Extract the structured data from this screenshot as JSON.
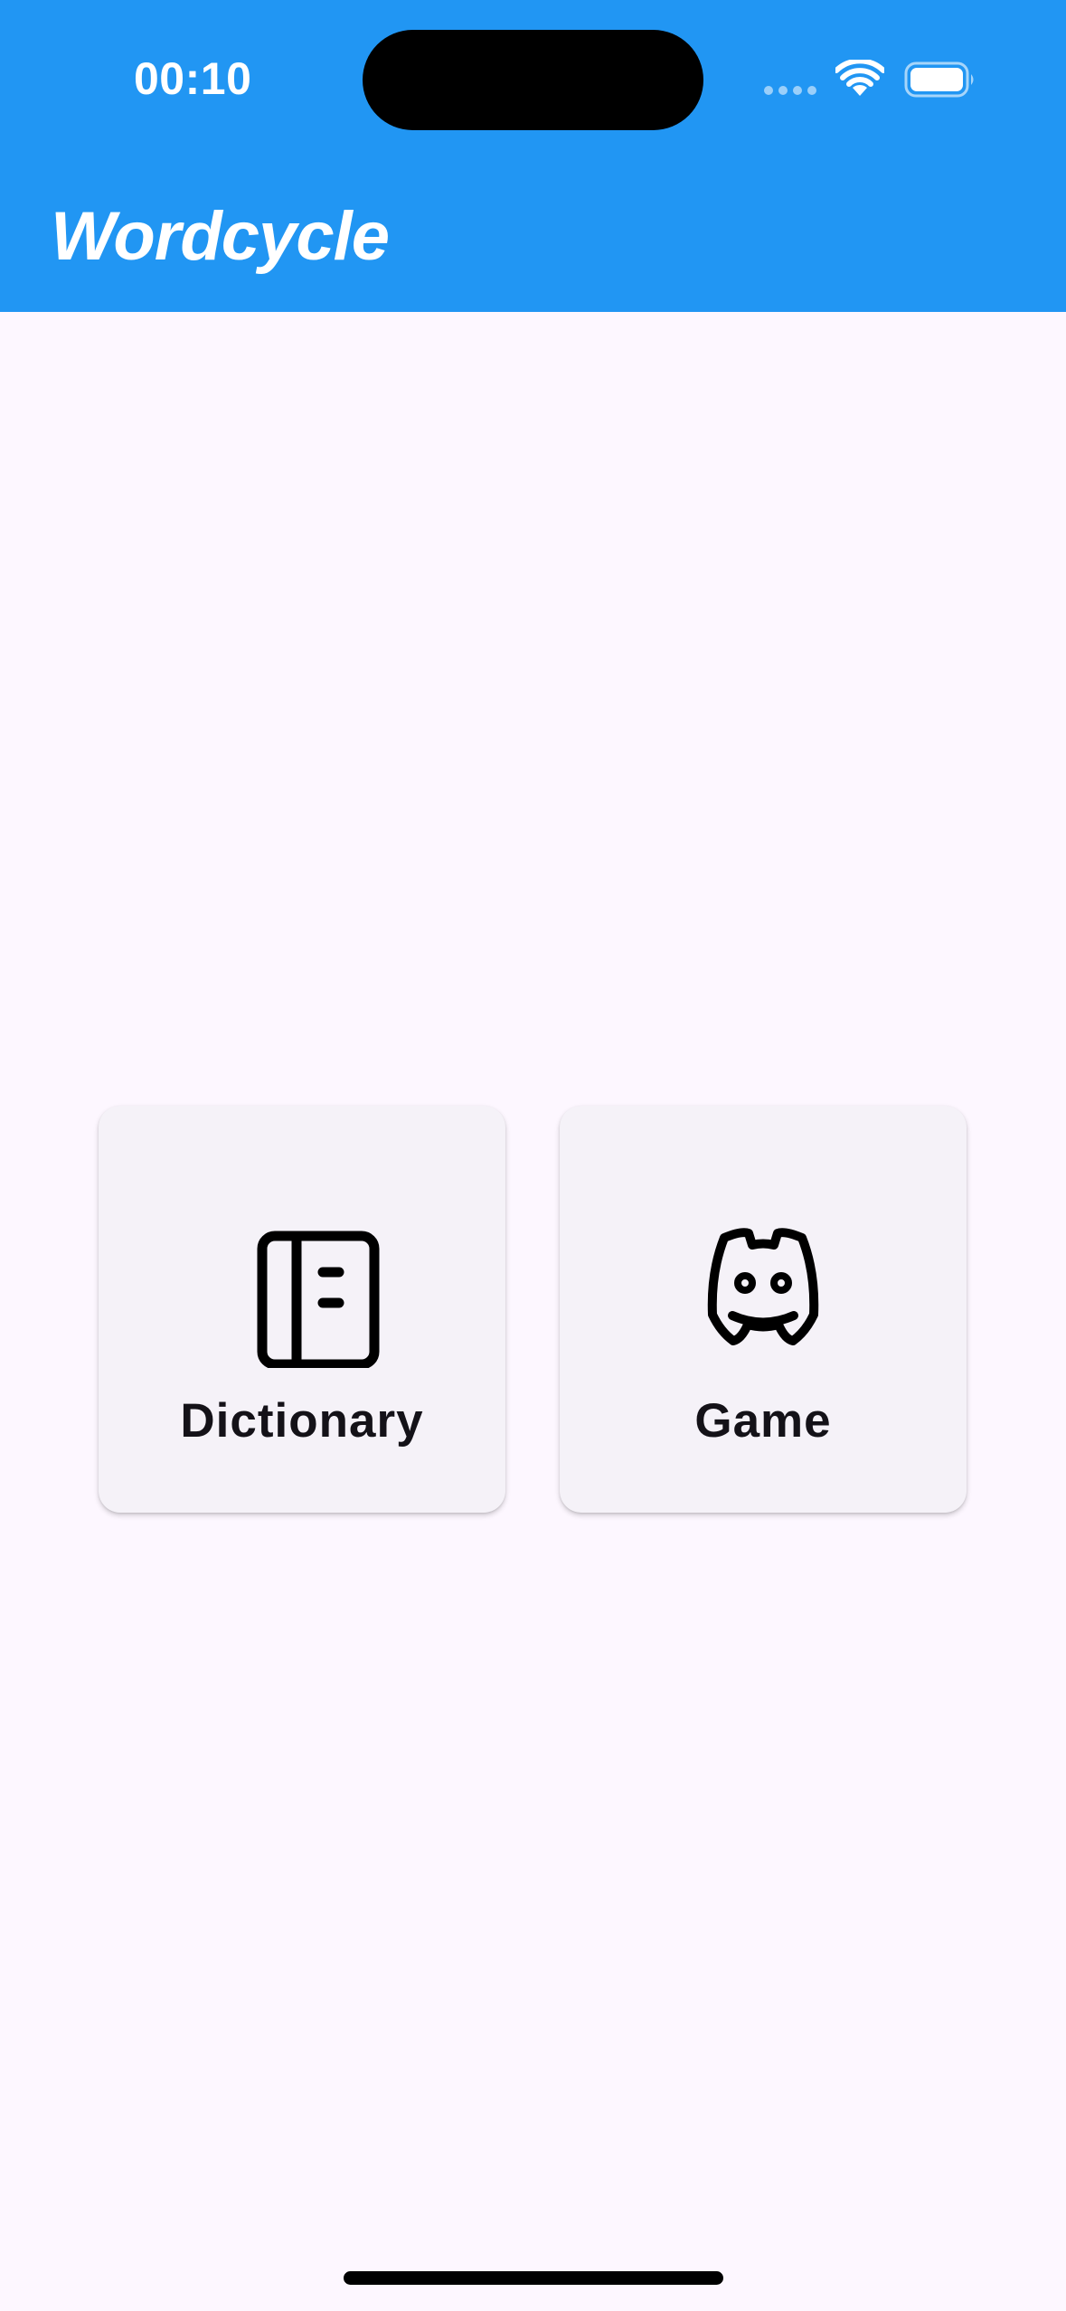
{
  "status_bar": {
    "time": "00:10",
    "icons": [
      "signal-icon",
      "wifi-icon",
      "battery-icon"
    ]
  },
  "app_bar": {
    "title": "Wordcycle",
    "background_color": "#2196F3"
  },
  "menu": {
    "cards": [
      {
        "label": "Dictionary",
        "icon": "book-icon"
      },
      {
        "label": "Game",
        "icon": "discord-icon"
      }
    ]
  },
  "colors": {
    "background": "#FDF7FF",
    "card": "#F5F2F8",
    "text": "#141218"
  }
}
